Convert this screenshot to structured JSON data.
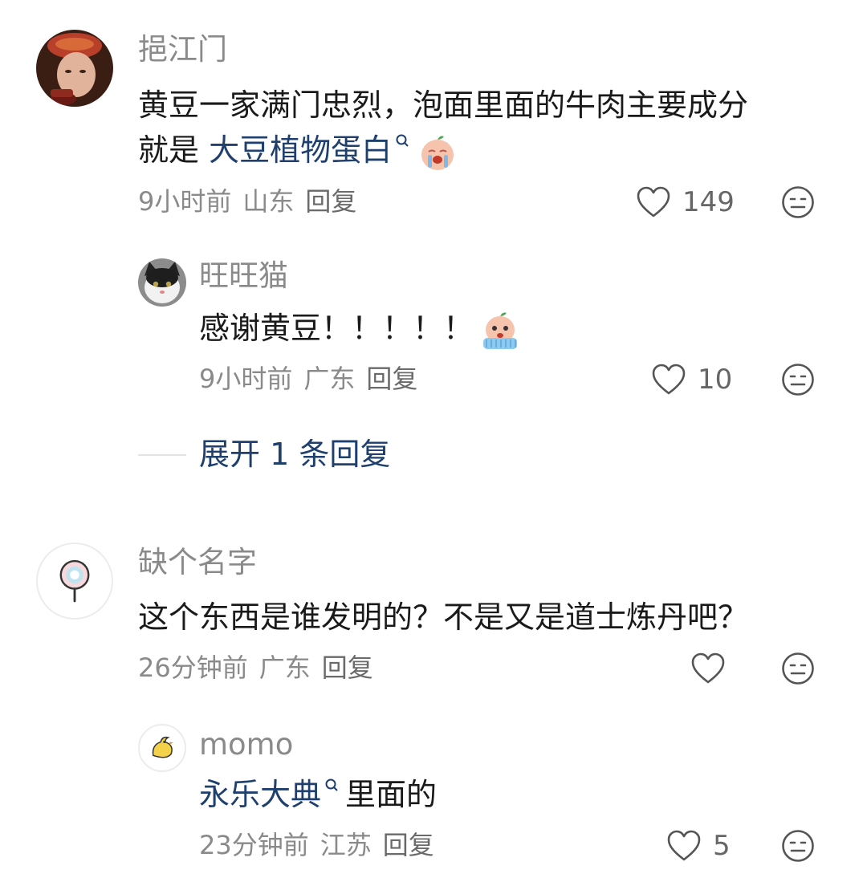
{
  "comments": [
    {
      "user": "挹江门",
      "text_plain": "黄豆一家满门忠烈，泡面里面的牛肉主要成分",
      "text_line2_prefix": "就是 ",
      "text_link": "大豆植物蛋白",
      "emoji": "crying-soybean-emoji",
      "time": "9小时前",
      "location": "山东",
      "reply_label": "回复",
      "likes": "149",
      "replies": [
        {
          "user": "旺旺猫",
          "text": "感谢黄豆！！！！！",
          "emoji": "teary-soybean-emoji",
          "time": "9小时前",
          "location": "广东",
          "reply_label": "回复",
          "likes": "10"
        }
      ],
      "expand_label": "展开 1 条回复"
    },
    {
      "user": "缺个名字",
      "text": "这个东西是谁发明的？不是又是道士炼丹吧？",
      "time": "26分钟前",
      "location": "广东",
      "reply_label": "回复",
      "likes": "",
      "replies": [
        {
          "user": "momo",
          "text_link": "永乐大典",
          "text_suffix": "里面的",
          "time": "23分钟前",
          "location": "江苏",
          "reply_label": "回复",
          "likes": "5"
        }
      ]
    }
  ],
  "colors": {
    "link": "#1f3f6e",
    "meta": "#8a8a8a",
    "name": "#8a8a8a",
    "text": "#1a1a1a"
  }
}
